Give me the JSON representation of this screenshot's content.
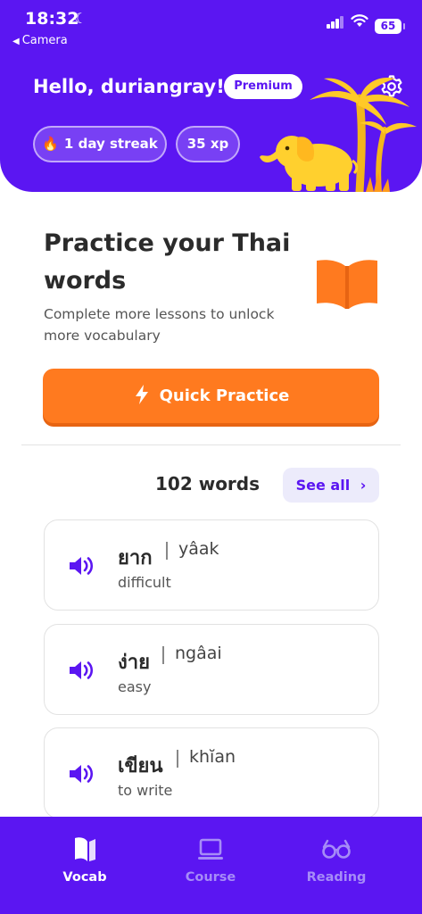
{
  "status_bar": {
    "time": "18:32",
    "back_label": "Camera",
    "battery": "65"
  },
  "header": {
    "greeting": "Hello, duriangray!",
    "premium_label": "Premium",
    "streak_label": "1 day streak",
    "xp_label": "35 xp"
  },
  "practice": {
    "title": "Practice your Thai words",
    "subtitle": "Complete more lessons to unlock more vocabulary",
    "quick_practice_label": "Quick Practice"
  },
  "vocab": {
    "count_label": "102 words",
    "see_all_label": "See all",
    "words": [
      {
        "thai": "ยาก",
        "roman": "yâak",
        "meaning": "difficult"
      },
      {
        "thai": "ง่าย",
        "roman": "ngâai",
        "meaning": "easy"
      },
      {
        "thai": "เขียน",
        "roman": "khĭan",
        "meaning": "to write"
      }
    ]
  },
  "bottom_nav": {
    "items": [
      {
        "label": "Vocab",
        "icon": "bookmark-book-icon",
        "active": true
      },
      {
        "label": "Course",
        "icon": "laptop-icon",
        "active": false
      },
      {
        "label": "Reading",
        "icon": "glasses-icon",
        "active": false
      }
    ]
  },
  "colors": {
    "brand_purple": "#5b16f2",
    "accent_orange": "#ff7a1f",
    "see_all_bg": "#ecebfb"
  }
}
